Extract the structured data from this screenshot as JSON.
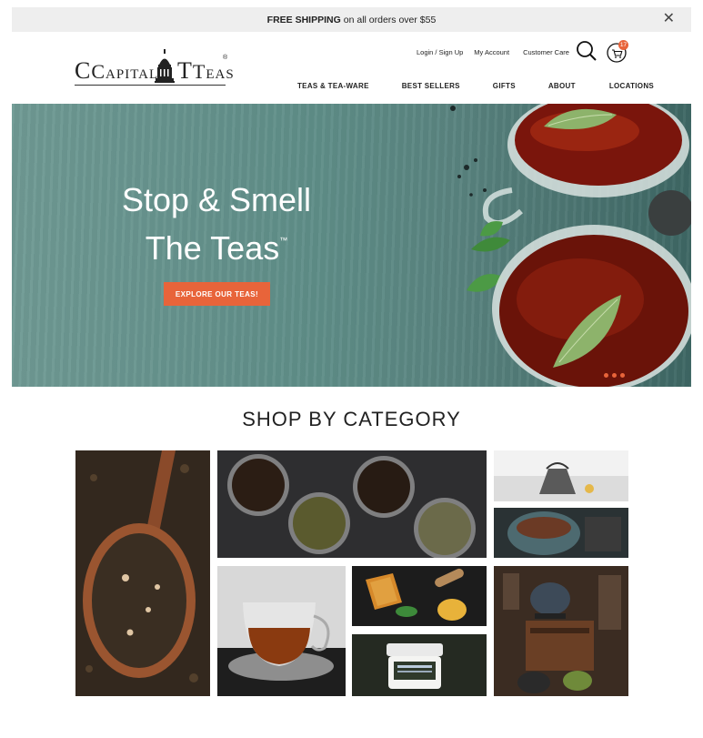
{
  "promo": {
    "bold": "FREE SHIPPING",
    "rest": "on all orders over $55",
    "close_glyph": "✕"
  },
  "logo": {
    "word1": "Capital",
    "word2": "Teas",
    "mark": "®"
  },
  "utility": {
    "login": "Login / Sign Up",
    "account": "My Account",
    "care": "Customer Care",
    "cart_count": "17"
  },
  "nav": [
    {
      "label": "TEAS & TEA-WARE"
    },
    {
      "label": "BEST SELLERS"
    },
    {
      "label": "GIFTS"
    },
    {
      "label": "ABOUT"
    },
    {
      "label": "LOCATIONS"
    }
  ],
  "hero": {
    "line1": "Stop & Smell",
    "line2": "The Teas",
    "tm": "™",
    "cta": "EXPLORE OUR TEAS!"
  },
  "category": {
    "title": "SHOP BY CATEGORY"
  },
  "colors": {
    "accent": "#e8643a",
    "teal": "#5f8e88",
    "promo_bg": "#eeeeee"
  }
}
